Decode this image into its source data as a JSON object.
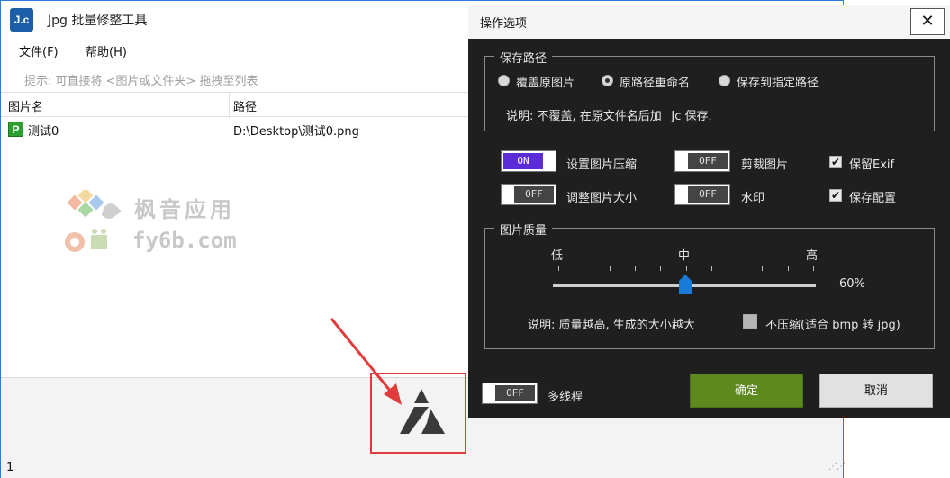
{
  "main_window": {
    "title": "Jpg 批量修整工具",
    "logo_text": "J.c",
    "menu": [
      {
        "label": "文件(F)"
      },
      {
        "label": "帮助(H)"
      }
    ],
    "hint": "提示: 可直接将 <图片或文件夹> 拖拽至列表",
    "columns": [
      "图片名",
      "路径"
    ],
    "rows": [
      {
        "icon": "P",
        "name": "测试0",
        "path": "D:\\Desktop\\测试0.png"
      }
    ],
    "watermark_cn": "枫音应用",
    "watermark_en": "fy6b.com",
    "status_count": "1"
  },
  "dialog": {
    "title": "操作选项",
    "close_label": "✕",
    "save_path": {
      "group_label": "保存路径",
      "options": [
        {
          "label": "覆盖原图片",
          "selected": false
        },
        {
          "label": "原路径重命名",
          "selected": true
        },
        {
          "label": "保存到指定路径",
          "selected": false
        }
      ],
      "description": "说明: 不覆盖, 在原文件名后加 _Jc 保存."
    },
    "toggles": [
      {
        "state": "ON",
        "label": "设置图片压缩"
      },
      {
        "state": "OFF",
        "label": "剪裁图片"
      },
      {
        "state": "OFF",
        "label": "调整图片大小"
      },
      {
        "state": "OFF",
        "label": "水印"
      }
    ],
    "checks": [
      {
        "label": "保留Exif",
        "checked": true
      },
      {
        "label": "保存配置",
        "checked": true
      }
    ],
    "quality": {
      "group_label": "图片质量",
      "low": "低",
      "mid": "中",
      "high": "高",
      "value": 60,
      "value_label": "60%",
      "description": "说明: 质量越高, 生成的大小越大",
      "no_compress_label": "不压缩(适合 bmp 转 jpg)",
      "no_compress_checked": false
    },
    "multithread": {
      "state": "OFF",
      "label": "多线程"
    },
    "ok_label": "确定",
    "cancel_label": "取消"
  },
  "colors": {
    "toggle_on": "#5a2bd6",
    "ok_button": "#5c8a1e",
    "dialog_bg": "#1f1f1f",
    "annotation_red": "#e23b3b"
  }
}
